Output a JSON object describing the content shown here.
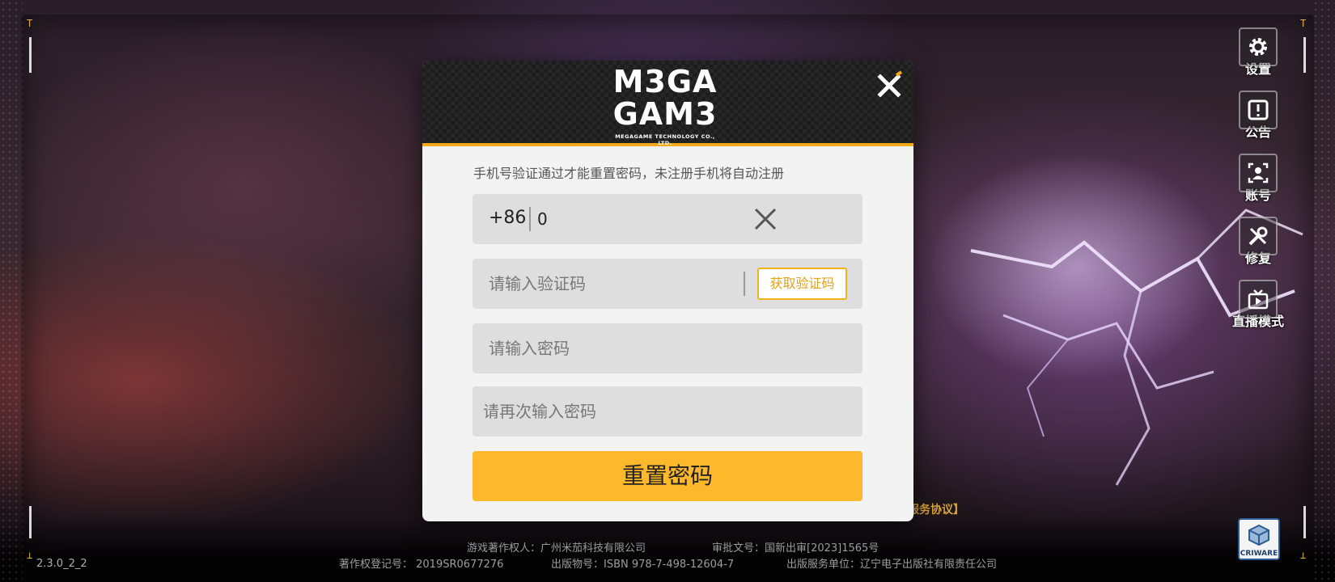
{
  "version": "2.3.0_2_2",
  "modal": {
    "logo_line1": "M3GA",
    "logo_line2": "GAM3",
    "logo_subtitle": "MEGAGAME TECHNOLOGY CO., LTD.",
    "notice": "手机号验证通过才能重置密码，未注册手机将自动注册",
    "phone": {
      "country_code": "+86",
      "value": "0"
    },
    "code": {
      "placeholder": "请输入验证码",
      "get_code_label": "获取验证码"
    },
    "password": {
      "placeholder": "请输入密码"
    },
    "password_confirm": {
      "placeholder": "请再次输入密码"
    },
    "submit_label": "重置密码",
    "accent_color": "#fdb92b"
  },
  "side_menu": {
    "items": [
      {
        "label": "设置",
        "icon": "gear-icon"
      },
      {
        "label": "公告",
        "icon": "exclamation-icon"
      },
      {
        "label": "账号",
        "icon": "user-icon"
      },
      {
        "label": "修复",
        "icon": "wrench-icon"
      },
      {
        "label": "直播模式",
        "icon": "tv-play-icon"
      }
    ]
  },
  "criware_label": "CRIWARE",
  "terms_fragment": "服务协议】",
  "footer": {
    "copyright_holder": "游戏著作权人：广州米茄科技有限公司",
    "approval_number": "审批文号：国新出审[2023]1565号",
    "registration_number": "著作权登记号： 2019SR0677276",
    "publication_number": "出版物号：ISBN 978-7-498-12604-7",
    "publisher": "出版服务单位：辽宁电子出版社有限责任公司"
  }
}
